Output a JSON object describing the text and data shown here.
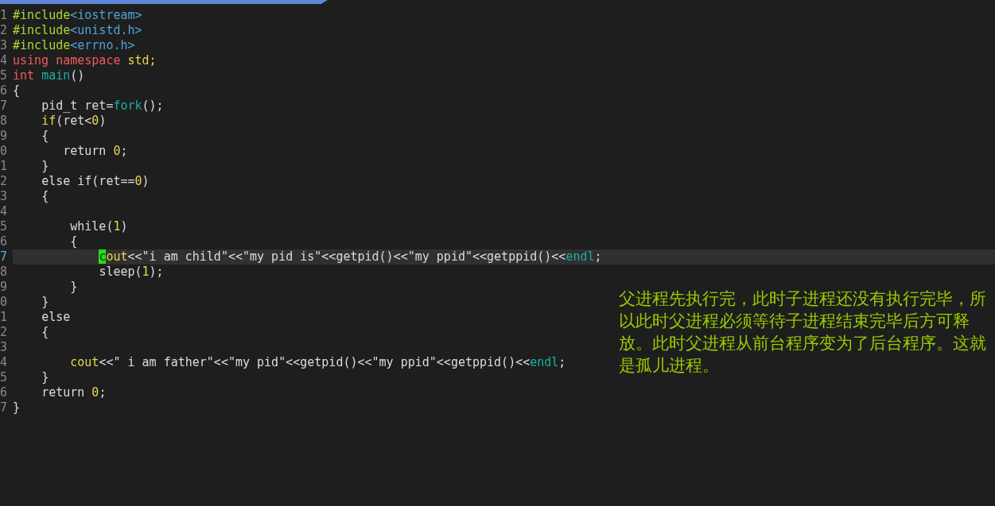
{
  "editor": {
    "lines": [
      {
        "number": "1",
        "current": false,
        "segments": [
          {
            "text": "#include",
            "kind": "preproc"
          },
          {
            "text": "<iostream>",
            "kind": "header"
          }
        ]
      },
      {
        "number": "2",
        "current": false,
        "segments": [
          {
            "text": "#include",
            "kind": "preproc"
          },
          {
            "text": "<unistd.h>",
            "kind": "header"
          }
        ]
      },
      {
        "number": "3",
        "current": false,
        "segments": [
          {
            "text": "#include",
            "kind": "preproc"
          },
          {
            "text": "<errno.h>",
            "kind": "header"
          }
        ]
      },
      {
        "number": "4",
        "current": false,
        "segments": [
          {
            "text": "using namespace ",
            "kind": "keyword"
          },
          {
            "text": "std;",
            "kind": "literal"
          }
        ]
      },
      {
        "number": "5",
        "current": false,
        "segments": [
          {
            "text": "int ",
            "kind": "keyword"
          },
          {
            "text": "main",
            "kind": "function"
          },
          {
            "text": "()",
            "kind": "plain"
          }
        ]
      },
      {
        "number": "6",
        "current": false,
        "segments": [
          {
            "text": "{",
            "kind": "plain"
          }
        ]
      },
      {
        "number": "7",
        "current": false,
        "segments": [
          {
            "text": "    pid_t ret=",
            "kind": "plain"
          },
          {
            "text": "fork",
            "kind": "function"
          },
          {
            "text": "();",
            "kind": "plain"
          }
        ]
      },
      {
        "number": "8",
        "current": false,
        "segments": [
          {
            "text": "    if",
            "kind": "literal"
          },
          {
            "text": "(ret<",
            "kind": "plain"
          },
          {
            "text": "0",
            "kind": "literal"
          },
          {
            "text": ")",
            "kind": "plain"
          }
        ]
      },
      {
        "number": "9",
        "current": false,
        "segments": [
          {
            "text": "    {",
            "kind": "plain"
          }
        ]
      },
      {
        "number": "0",
        "current": false,
        "segments": [
          {
            "text": "       return ",
            "kind": "plain"
          },
          {
            "text": "0",
            "kind": "literal"
          },
          {
            "text": ";",
            "kind": "plain"
          }
        ]
      },
      {
        "number": "1",
        "current": false,
        "segments": [
          {
            "text": "    }",
            "kind": "plain"
          }
        ]
      },
      {
        "number": "2",
        "current": false,
        "segments": [
          {
            "text": "    else if(ret==",
            "kind": "plain"
          },
          {
            "text": "0",
            "kind": "literal"
          },
          {
            "text": ")",
            "kind": "plain"
          }
        ]
      },
      {
        "number": "3",
        "current": false,
        "segments": [
          {
            "text": "    {",
            "kind": "plain"
          }
        ]
      },
      {
        "number": "4",
        "current": false
      },
      {
        "number": "5",
        "current": false,
        "segments": [
          {
            "text": "        while(",
            "kind": "plain"
          },
          {
            "text": "1",
            "kind": "literal"
          },
          {
            "text": ")",
            "kind": "plain"
          }
        ]
      },
      {
        "number": "6",
        "current": false,
        "segments": [
          {
            "text": "        {",
            "kind": "plain"
          }
        ]
      },
      {
        "number": "7",
        "current": true,
        "segments": [
          {
            "text": "            c",
            "kind": "cursor"
          },
          {
            "text": "out",
            "kind": "literal"
          },
          {
            "text": "<<\"i am child\"<<\"my pid is\"<<getpid()<<\"my ppid\"<<getppid()<<",
            "kind": "plain"
          },
          {
            "text": "endl",
            "kind": "function"
          },
          {
            "text": ";",
            "kind": "plain"
          }
        ]
      },
      {
        "number": "8",
        "current": false,
        "segments": [
          {
            "text": "            sleep(",
            "kind": "plain"
          },
          {
            "text": "1",
            "kind": "literal"
          },
          {
            "text": ");",
            "kind": "plain"
          }
        ]
      },
      {
        "number": "9",
        "current": false,
        "segments": [
          {
            "text": "        }",
            "kind": "plain"
          }
        ]
      },
      {
        "number": "0",
        "current": false,
        "segments": [
          {
            "text": "    }",
            "kind": "plain"
          }
        ]
      },
      {
        "number": "1",
        "current": false,
        "segments": [
          {
            "text": "    else",
            "kind": "plain"
          }
        ]
      },
      {
        "number": "2",
        "current": false,
        "segments": [
          {
            "text": "    {",
            "kind": "plain"
          }
        ]
      },
      {
        "number": "3",
        "current": false
      },
      {
        "number": "4",
        "current": false,
        "segments": [
          {
            "text": "        cout",
            "kind": "literal"
          },
          {
            "text": "<<\" i am father\"<<\"my pid\"<<getpid()<<\"my ppid\"<<getppid()<<",
            "kind": "plain"
          },
          {
            "text": "endl",
            "kind": "function"
          },
          {
            "text": ";",
            "kind": "plain"
          }
        ]
      },
      {
        "number": "5",
        "current": false,
        "segments": [
          {
            "text": "    }",
            "kind": "plain"
          }
        ]
      },
      {
        "number": "6",
        "current": false,
        "segments": [
          {
            "text": "    return ",
            "kind": "plain"
          },
          {
            "text": "0",
            "kind": "literal"
          },
          {
            "text": ";",
            "kind": "plain"
          }
        ]
      },
      {
        "number": "7",
        "current": false,
        "segments": [
          {
            "text": "}",
            "kind": "plain"
          }
        ]
      }
    ]
  },
  "annotation": "父进程先执行完，此时子进程还没有执行完毕，所以此时父进程必须等待子进程结束完毕后方可释放。此时父进程从前台程序变为了后台程序。这就是孤儿进程。"
}
